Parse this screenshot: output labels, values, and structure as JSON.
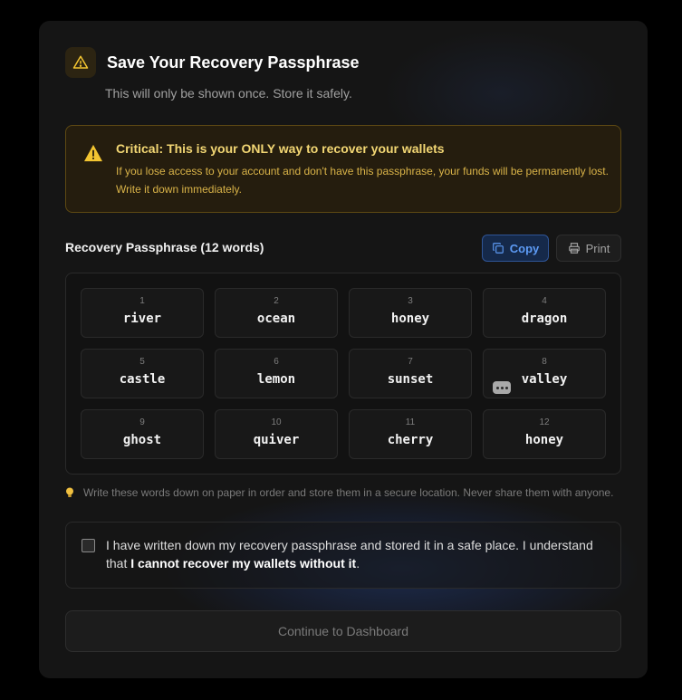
{
  "header": {
    "title": "Save Your Recovery Passphrase",
    "subtitle": "This will only be shown once. Store it safely.",
    "icon": "warning-icon"
  },
  "alert": {
    "title": "Critical: This is your ONLY way to recover your wallets",
    "text": "If you lose access to your account and don't have this passphrase, your funds will be permanently lost. Write it down immediately.",
    "icon": "warning-icon",
    "accent": "#f3d774"
  },
  "passphrase": {
    "label": "Recovery Passphrase (12 words)",
    "copy_label": "Copy",
    "print_label": "Print",
    "words": [
      {
        "num": "1",
        "word": "river"
      },
      {
        "num": "2",
        "word": "ocean"
      },
      {
        "num": "3",
        "word": "honey"
      },
      {
        "num": "4",
        "word": "dragon"
      },
      {
        "num": "5",
        "word": "castle"
      },
      {
        "num": "6",
        "word": "lemon"
      },
      {
        "num": "7",
        "word": "sunset"
      },
      {
        "num": "8",
        "word": "valley"
      },
      {
        "num": "9",
        "word": "ghost"
      },
      {
        "num": "10",
        "word": "quiver"
      },
      {
        "num": "11",
        "word": "cherry"
      },
      {
        "num": "12",
        "word": "honey"
      }
    ]
  },
  "tip": {
    "icon": "lightbulb-icon",
    "text": "Write these words down on paper in order and store them in a secure location. Never share them with anyone."
  },
  "confirm": {
    "checked": false,
    "text_before": "I have written down my recovery passphrase and stored it in a safe place. I understand that ",
    "text_bold": "I cannot recover my wallets without it",
    "text_after": "."
  },
  "continue_label": "Continue to Dashboard",
  "colors": {
    "modal_bg": "#151515",
    "accent_blue": "#5d9bf5",
    "warning_yellow": "#f3c531"
  }
}
